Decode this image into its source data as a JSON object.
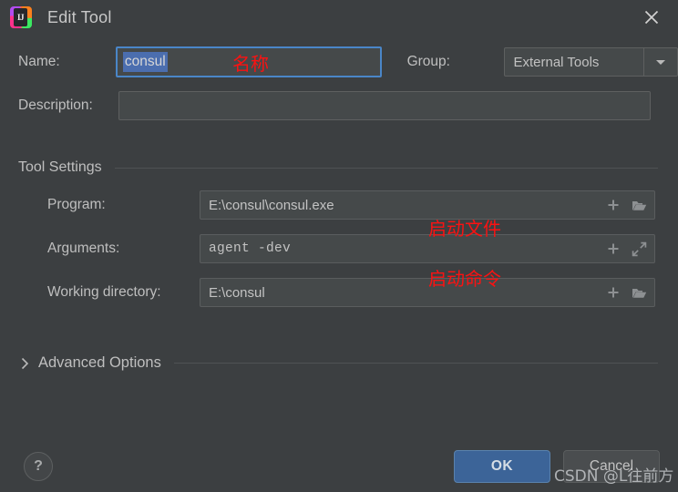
{
  "window": {
    "title": "Edit Tool",
    "app_icon": "intellij-idea-icon",
    "close_icon": "close-icon"
  },
  "form": {
    "name_label": "Name:",
    "name_value": "consul",
    "group_label": "Group:",
    "group_value": "External Tools",
    "group_arrow_icon": "chevron-down-icon",
    "description_label": "Description:",
    "description_value": "",
    "description_placeholder": ""
  },
  "tool_settings": {
    "section_title": "Tool Settings",
    "rows": [
      {
        "label": "Program:",
        "value": "E:\\consul\\consul.exe",
        "icons": [
          "plus-icon",
          "folder-icon"
        ]
      },
      {
        "label": "Arguments:",
        "value": "agent -dev",
        "icons": [
          "plus-icon",
          "expand-icon"
        ]
      },
      {
        "label": "Working directory:",
        "value": "E:\\consul",
        "icons": [
          "plus-icon",
          "folder-icon"
        ]
      }
    ]
  },
  "advanced": {
    "label": "Advanced Options",
    "chevron_icon": "chevron-right-icon",
    "expanded": false
  },
  "footer": {
    "help_label": "?",
    "ok_label": "OK",
    "cancel_label": "Cancel"
  },
  "annotations": [
    {
      "text": "名称",
      "target": "name-field"
    },
    {
      "text": "启动文件",
      "target": "program-field"
    },
    {
      "text": "启动命令",
      "target": "arguments-field"
    }
  ],
  "watermark": "CSDN @L往前方",
  "colors": {
    "background": "#3c3f41",
    "field_background": "#45494a",
    "focus_border": "#4a86c8",
    "selection": "#4b6eaf",
    "ok_button": "#3c6498",
    "annotation_red": "#fb1212",
    "text": "#bbbbbb"
  }
}
